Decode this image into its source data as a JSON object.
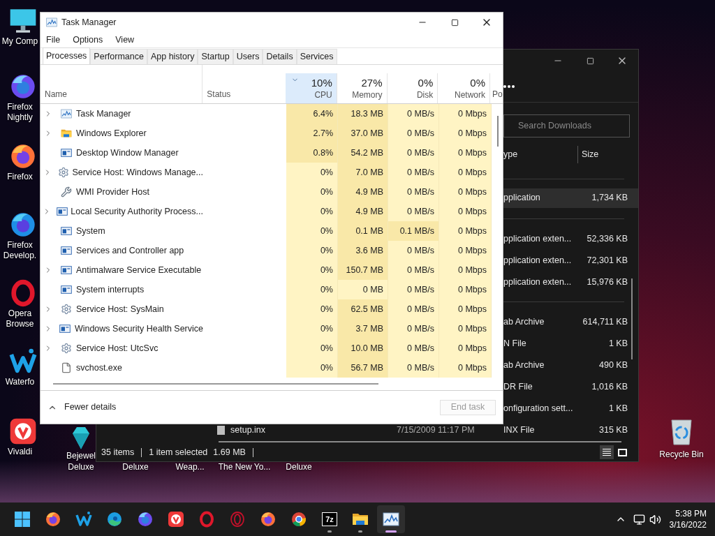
{
  "desktop": {
    "icons": [
      {
        "label": "My Comp",
        "kind": "computer"
      },
      {
        "label": "Firefox Nightly",
        "kind": "nightly"
      },
      {
        "label": "Firefox",
        "kind": "firefox"
      },
      {
        "label": "Firefox Develop.",
        "kind": "devedition"
      },
      {
        "label": "Opera Browse",
        "kind": "opera"
      },
      {
        "label": "Waterfo",
        "kind": "waterfox"
      },
      {
        "label": "Vivaldi",
        "kind": "vivaldi"
      }
    ],
    "bottom_icons": [
      {
        "label": "Bejewel Deluxe",
        "kind": "gem"
      },
      {
        "label": "Deluxe"
      },
      {
        "label": "Weap..."
      },
      {
        "label": "The New Yo..."
      },
      {
        "label": "Deluxe"
      }
    ],
    "recycle_bin": {
      "label": "Recycle Bin"
    }
  },
  "explorer": {
    "search": {
      "placeholder": "Search Downloads"
    },
    "columns": [
      "ype",
      "Size"
    ],
    "groups": [
      {
        "rows": [
          {
            "type": "pplication",
            "size": "1,734 KB",
            "selected": true
          }
        ]
      },
      {
        "rows": [
          {
            "type": "pplication exten...",
            "size": "52,336 KB",
            "selected": false
          },
          {
            "type": "pplication exten...",
            "size": "72,301 KB",
            "selected": false
          },
          {
            "type": "pplication exten...",
            "size": "15,976 KB",
            "selected": false
          }
        ]
      },
      {
        "rows": [
          {
            "type": "ab Archive",
            "size": "614,711 KB",
            "selected": false
          },
          {
            "type": "N File",
            "size": "1 KB",
            "selected": false
          },
          {
            "type": "ab Archive",
            "size": "490 KB",
            "selected": false
          },
          {
            "type": "DR File",
            "size": "1,016 KB",
            "selected": false
          },
          {
            "type": "onfiguration sett...",
            "size": "1 KB",
            "selected": false
          },
          {
            "name": "setup.inx",
            "date": "7/15/2009 11:17 PM",
            "type": "INX File",
            "size": "315 KB",
            "selected": false
          }
        ]
      }
    ],
    "status": {
      "count": "35 items",
      "selection": "1 item selected",
      "size": "1.69 MB"
    }
  },
  "task_manager": {
    "title": "Task Manager",
    "menu": [
      "File",
      "Options",
      "View"
    ],
    "tabs": [
      {
        "label": "Processes",
        "selected": true
      },
      {
        "label": "Performance",
        "selected": false
      },
      {
        "label": "App history",
        "selected": false
      },
      {
        "label": "Startup",
        "selected": false
      },
      {
        "label": "Users",
        "selected": false
      },
      {
        "label": "Details",
        "selected": false
      },
      {
        "label": "Services",
        "selected": false
      }
    ],
    "columns": [
      {
        "label": "Name"
      },
      {
        "label": "Status"
      },
      {
        "percent": "10%",
        "label": "CPU",
        "sorted": true
      },
      {
        "percent": "27%",
        "label": "Memory",
        "sorted": false
      },
      {
        "percent": "0%",
        "label": "Disk",
        "sorted": false
      },
      {
        "percent": "0%",
        "label": "Network",
        "sorted": false
      },
      {
        "label": "Po"
      }
    ],
    "rows": [
      {
        "name": "Task Manager",
        "status": "",
        "cpu": {
          "text": "6.4%",
          "hot": true
        },
        "memory": {
          "text": "18.3 MB",
          "hot": true
        },
        "disk": {
          "text": "0 MB/s",
          "hot": false
        },
        "network": {
          "text": "0 Mbps",
          "hot": false
        },
        "kind": "taskmgr",
        "expandable": true
      },
      {
        "name": "Windows Explorer",
        "status": "",
        "cpu": {
          "text": "2.7%",
          "hot": true
        },
        "memory": {
          "text": "37.0 MB",
          "hot": true
        },
        "disk": {
          "text": "0 MB/s",
          "hot": false
        },
        "network": {
          "text": "0 Mbps",
          "hot": false
        },
        "kind": "folder",
        "expandable": true
      },
      {
        "name": "Desktop Window Manager",
        "status": "",
        "cpu": {
          "text": "0.8%",
          "hot": true
        },
        "memory": {
          "text": "54.2 MB",
          "hot": true
        },
        "disk": {
          "text": "0 MB/s",
          "hot": false
        },
        "network": {
          "text": "0 Mbps",
          "hot": false
        },
        "kind": "app",
        "expandable": false
      },
      {
        "name": "Service Host: Windows Manage...",
        "status": "",
        "cpu": {
          "text": "0%",
          "hot": false
        },
        "memory": {
          "text": "7.0 MB",
          "hot": true
        },
        "disk": {
          "text": "0 MB/s",
          "hot": false
        },
        "network": {
          "text": "0 Mbps",
          "hot": false
        },
        "kind": "gear",
        "expandable": true
      },
      {
        "name": "WMI Provider Host",
        "status": "",
        "cpu": {
          "text": "0%",
          "hot": false
        },
        "memory": {
          "text": "4.9 MB",
          "hot": true
        },
        "disk": {
          "text": "0 MB/s",
          "hot": false
        },
        "network": {
          "text": "0 Mbps",
          "hot": false
        },
        "kind": "wmi",
        "expandable": false
      },
      {
        "name": "Local Security Authority Process...",
        "status": "",
        "cpu": {
          "text": "0%",
          "hot": false
        },
        "memory": {
          "text": "4.9 MB",
          "hot": true
        },
        "disk": {
          "text": "0 MB/s",
          "hot": false
        },
        "network": {
          "text": "0 Mbps",
          "hot": false
        },
        "kind": "app",
        "expandable": true
      },
      {
        "name": "System",
        "status": "",
        "cpu": {
          "text": "0%",
          "hot": false
        },
        "memory": {
          "text": "0.1 MB",
          "hot": true
        },
        "disk": {
          "text": "0.1 MB/s",
          "hot": true
        },
        "network": {
          "text": "0 Mbps",
          "hot": false
        },
        "kind": "app",
        "expandable": false
      },
      {
        "name": "Services and Controller app",
        "status": "",
        "cpu": {
          "text": "0%",
          "hot": false
        },
        "memory": {
          "text": "3.6 MB",
          "hot": true
        },
        "disk": {
          "text": "0 MB/s",
          "hot": false
        },
        "network": {
          "text": "0 Mbps",
          "hot": false
        },
        "kind": "app",
        "expandable": false
      },
      {
        "name": "Antimalware Service Executable",
        "status": "",
        "cpu": {
          "text": "0%",
          "hot": false
        },
        "memory": {
          "text": "150.7 MB",
          "hot": true
        },
        "disk": {
          "text": "0 MB/s",
          "hot": false
        },
        "network": {
          "text": "0 Mbps",
          "hot": false
        },
        "kind": "app",
        "expandable": true
      },
      {
        "name": "System interrupts",
        "status": "",
        "cpu": {
          "text": "0%",
          "hot": false
        },
        "memory": {
          "text": "0 MB",
          "hot": false
        },
        "disk": {
          "text": "0 MB/s",
          "hot": false
        },
        "network": {
          "text": "0 Mbps",
          "hot": false
        },
        "kind": "app",
        "expandable": false
      },
      {
        "name": "Service Host: SysMain",
        "status": "",
        "cpu": {
          "text": "0%",
          "hot": false
        },
        "memory": {
          "text": "62.5 MB",
          "hot": true
        },
        "disk": {
          "text": "0 MB/s",
          "hot": false
        },
        "network": {
          "text": "0 Mbps",
          "hot": false
        },
        "kind": "gear",
        "expandable": true
      },
      {
        "name": "Windows Security Health Service",
        "status": "",
        "cpu": {
          "text": "0%",
          "hot": false
        },
        "memory": {
          "text": "3.7 MB",
          "hot": true
        },
        "disk": {
          "text": "0 MB/s",
          "hot": false
        },
        "network": {
          "text": "0 Mbps",
          "hot": false
        },
        "kind": "app",
        "expandable": true
      },
      {
        "name": "Service Host: UtcSvc",
        "status": "",
        "cpu": {
          "text": "0%",
          "hot": false
        },
        "memory": {
          "text": "10.0 MB",
          "hot": true
        },
        "disk": {
          "text": "0 MB/s",
          "hot": false
        },
        "network": {
          "text": "0 Mbps",
          "hot": false
        },
        "kind": "gear",
        "expandable": true
      },
      {
        "name": "svchost.exe",
        "status": "",
        "cpu": {
          "text": "0%",
          "hot": false
        },
        "memory": {
          "text": "56.7 MB",
          "hot": true
        },
        "disk": {
          "text": "0 MB/s",
          "hot": false
        },
        "network": {
          "text": "0 Mbps",
          "hot": false
        },
        "kind": "exe",
        "expandable": false
      }
    ],
    "footer": {
      "toggle": "Fewer details",
      "end_task": {
        "label": "End task",
        "disabled": true
      }
    }
  },
  "taskbar": {
    "apps": [
      {
        "kind": "start",
        "running": false,
        "active": false
      },
      {
        "kind": "firefox",
        "running": false,
        "active": false
      },
      {
        "kind": "waterfox",
        "running": false,
        "active": false
      },
      {
        "kind": "edge",
        "running": false,
        "active": false
      },
      {
        "kind": "nightly",
        "running": false,
        "active": false
      },
      {
        "kind": "vivaldi",
        "running": false,
        "active": false
      },
      {
        "kind": "opera",
        "running": false,
        "active": false
      },
      {
        "kind": "operagx",
        "running": false,
        "active": false
      },
      {
        "kind": "firefox",
        "running": false,
        "active": false
      },
      {
        "kind": "chrome",
        "running": false,
        "active": false
      },
      {
        "kind": "archiver",
        "label": "7z",
        "running": true,
        "active": false
      },
      {
        "kind": "folder",
        "running": true,
        "active": false
      },
      {
        "kind": "taskmgr",
        "running": true,
        "active": true
      }
    ],
    "clock": {
      "time": "5:38 PM",
      "date": "3/16/2022"
    }
  }
}
